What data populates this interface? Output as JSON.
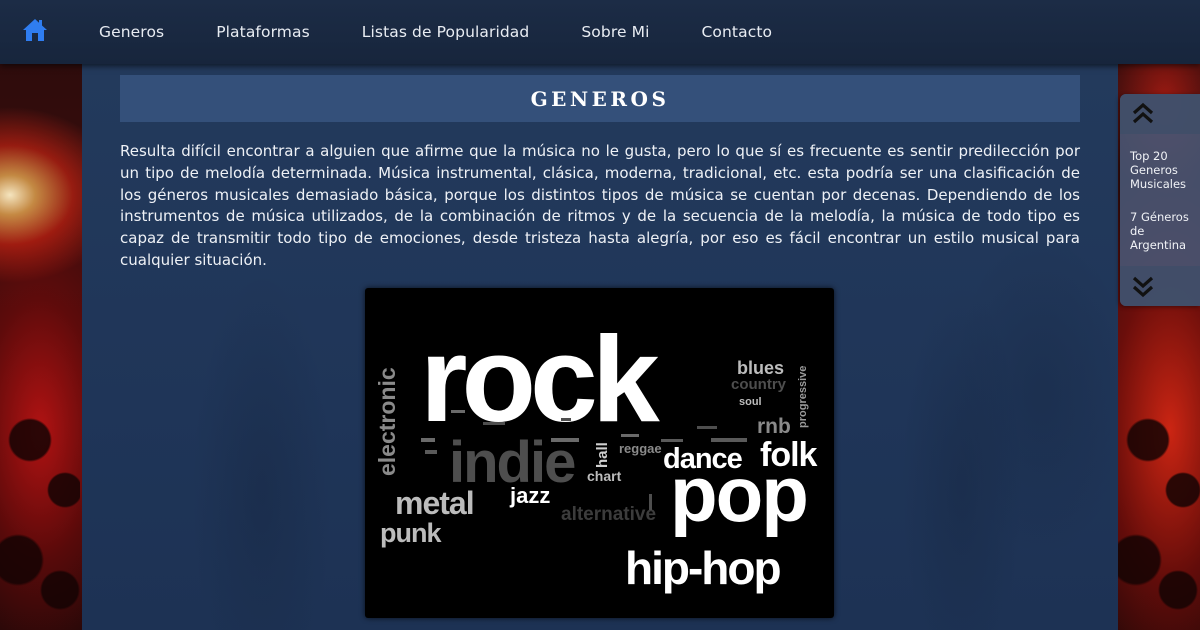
{
  "nav": {
    "home_icon": "home-icon",
    "items": [
      {
        "label": "Generos"
      },
      {
        "label": "Plataformas"
      },
      {
        "label": "Listas de Popularidad"
      },
      {
        "label": "Sobre Mi"
      },
      {
        "label": "Contacto"
      }
    ]
  },
  "main": {
    "title": "GENEROS",
    "intro": "Resulta difícil encontrar a alguien que afirme que la música no le gusta, pero lo que sí es frecuente es sentir predilección por un tipo de melodía determinada. Música instrumental, clásica, moderna, tradicional, etc. esta podría ser una clasificación de los géneros musicales demasiado básica, porque los distintos tipos de música se cuentan por decenas. Dependiendo de los instrumentos de música utilizados, de la combinación de ritmos y de la secuencia de la melodía, la música de todo tipo es capaz de transmitir todo tipo de emociones, desde tristeza hasta alegría, por eso es fácil encontrar un estilo musical para cualquier situación."
  },
  "word_cloud": {
    "words": [
      "rock",
      "indie",
      "pop",
      "hip-hop",
      "folk",
      "dance",
      "metal",
      "punk",
      "jazz",
      "electronic",
      "alternative",
      "blues",
      "country",
      "progressive",
      "soul",
      "rnb",
      "chart",
      "reggae",
      "hall"
    ]
  },
  "side_menu": {
    "up_icon": "double-chevron-up-icon",
    "down_icon": "double-chevron-down-icon",
    "links": [
      {
        "label": "Top 20 Generos Musicales"
      },
      {
        "label": "7 Géneros de Argentina"
      }
    ]
  },
  "colors": {
    "navbar": "#1c2c46",
    "panel": "#233a5c",
    "title_bar": "#34507a",
    "home_icon": "#2f7df0"
  }
}
